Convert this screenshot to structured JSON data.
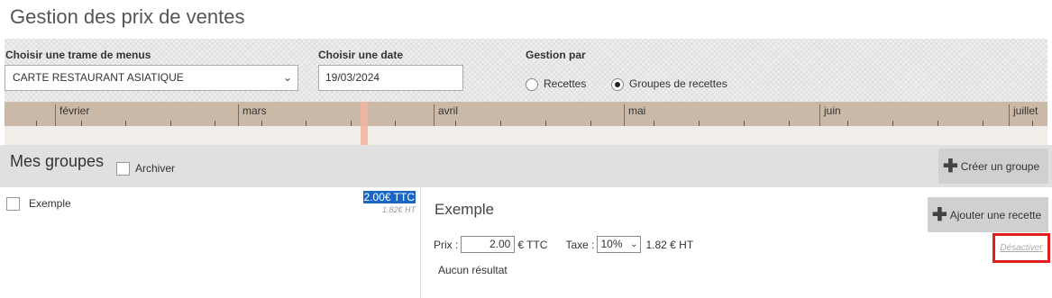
{
  "page": {
    "title": "Gestion des prix de ventes"
  },
  "filters": {
    "menu_label": "Choisir une trame de menus",
    "menu_value": "CARTE RESTAURANT ASIATIQUE",
    "date_label": "Choisir une date",
    "date_value": "19/03/2024",
    "mode_label": "Gestion par",
    "mode_options": [
      {
        "label": "Recettes",
        "selected": false
      },
      {
        "label": "Groupes de recettes",
        "selected": true
      }
    ]
  },
  "timeline": {
    "months": [
      "février",
      "mars",
      "avril",
      "mai",
      "juin",
      "juillet"
    ]
  },
  "groups": {
    "title": "Mes groupes",
    "archive_label": "Archiver",
    "create_label": "Créer un groupe",
    "items": [
      {
        "name": "Exemple",
        "price_ttc": "2.00€ TTC",
        "price_ht": "1.82€ HT"
      }
    ]
  },
  "detail": {
    "title": "Exemple",
    "add_recipe_label": "Ajouter une recette",
    "price_label": "Prix :",
    "price_value": "2.00",
    "price_unit": "€ TTC",
    "tax_label": "Taxe :",
    "tax_value": "10%",
    "ht_value": "1.82 € HT",
    "deactivate_label": "Désactiver",
    "no_result": "Aucun résultat"
  },
  "colors": {
    "timeline": "#cbb9a7",
    "today_marker": "#f3b49b",
    "highlight": "#1a66c4",
    "deactivate_box": "#e01e1e"
  }
}
